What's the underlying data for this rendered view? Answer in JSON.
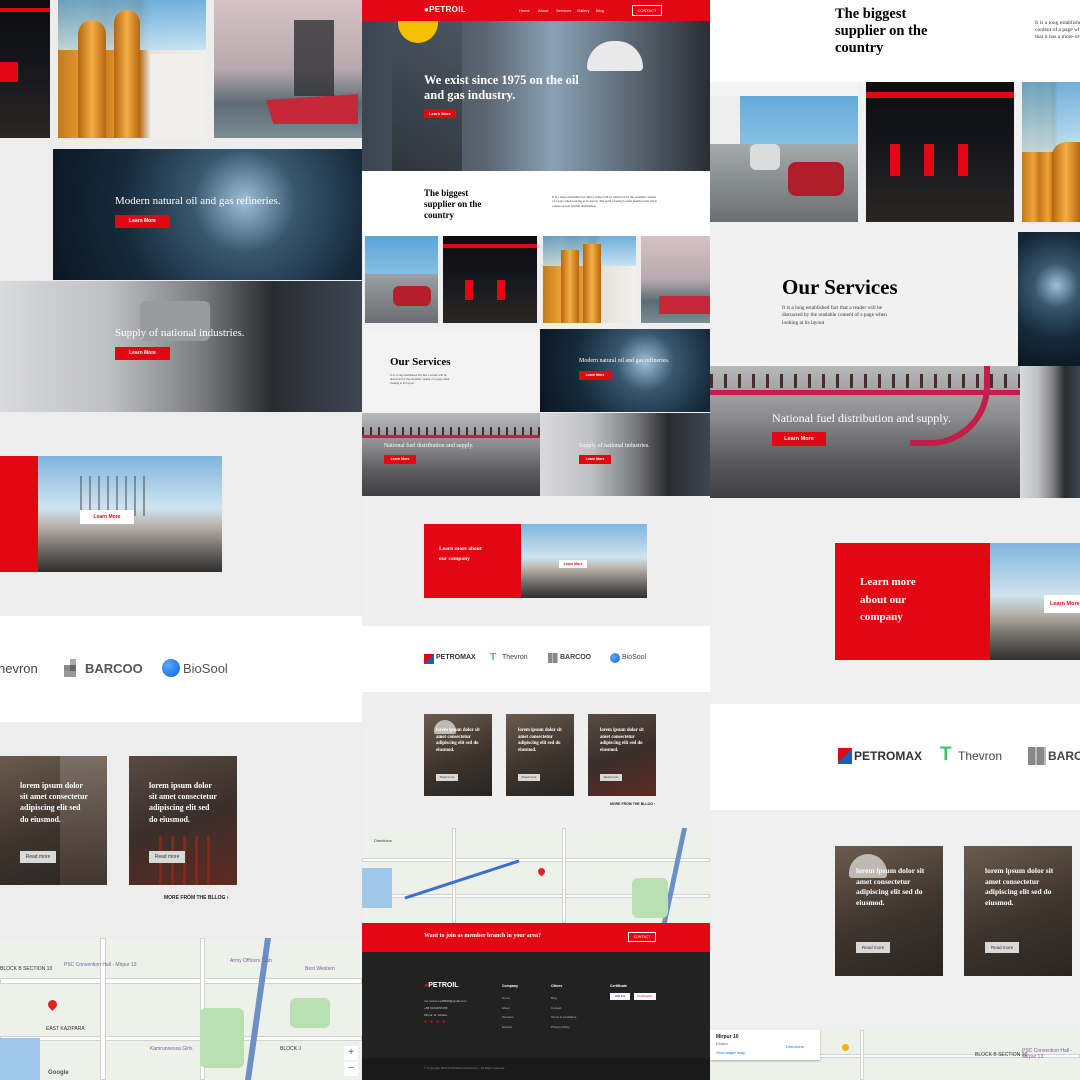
{
  "brand": {
    "name": "PETROIL",
    "accent": "#e30613"
  },
  "nav": {
    "links": [
      "Home",
      "About",
      "Services",
      "Gallery",
      "Blog"
    ],
    "contact_button": "CONTACT"
  },
  "hero": {
    "headline": "We exist since 1975 on the oil and gas industry.",
    "button": "Learn More"
  },
  "supplier": {
    "title": "The biggest supplier on the country",
    "body": "It is a long established fact that a reader will be distracted by the readable content of a page when looking at its layout. The point of using Lorem Ipsum is that it has a more-or-less normal distribution.",
    "body_right_crop": "It is a long establishe content of a page wha that it has a more-or-l"
  },
  "services": {
    "title": "Our Services",
    "body": "It is a long established fact that a reader will be distracted by the readable content of a page when looking at its layout",
    "items": [
      {
        "title": "Modern natural oil and gas refineries.",
        "button": "Learn More"
      },
      {
        "title": "National fuel distribution and supply.",
        "button": "Learn More"
      },
      {
        "title": "Supply of national industries.",
        "button": "Learn More"
      }
    ]
  },
  "about": {
    "text": "Learn more about our company",
    "button": "Learn More"
  },
  "partners": [
    {
      "name": "PETROMAX",
      "icon": "petromax-logo-icon"
    },
    {
      "name": "Thevron",
      "icon": "thevron-logo-icon"
    },
    {
      "name": "BARCOO",
      "icon": "barcoo-logo-icon"
    },
    {
      "name": "BioSool",
      "icon": "biosool-logo-icon"
    }
  ],
  "partners_left_crop": "hevron",
  "blog": {
    "posts": [
      {
        "title": "lorem ipsum dolor sit amet consectetur adipiscing elit sed do eiusmod.",
        "button": "Read more"
      },
      {
        "title": "lorem ipsum dolor sit amet consectetur adipiscing elit sed do eiusmod.",
        "button": "Read more"
      },
      {
        "title": "lorem ipsum dolor sit amet consectetur adipiscing elit sed do eiusmod.",
        "button": "Read more"
      }
    ],
    "more_link": "MORE FROM THE BLLOG"
  },
  "map": {
    "labels": [
      "PSC Convention Hall - Mirpur 13",
      "Army Officers Club",
      "Best Western",
      "EAST KAZIPARA",
      "BLOCK B SECTION 10",
      "Kamrunnessa Girls",
      "BLOCK J",
      "KAZIPARA",
      "Mirpur 10",
      "Dhaka",
      "View larger map",
      "Directions"
    ],
    "zoom_in": "+",
    "zoom_out": "−",
    "google": "Google"
  },
  "cta": {
    "text": "Want to join as member branch in your area?",
    "button": "CONTACT"
  },
  "footer": {
    "contacts": [
      "mo.mozum.ed8900@gmail.com",
      "+88 01234/56789",
      "Mirpur 11, Dhaka"
    ],
    "columns": [
      {
        "title": "Company",
        "items": [
          "Home",
          "About",
          "Services",
          "Explore"
        ]
      },
      {
        "title": "Others",
        "items": [
          "Blog",
          "Contact",
          "Terms & conditions",
          "Privacy Policy"
        ]
      },
      {
        "title": "Certificate",
        "items": [
          "ISO 9.9",
          "Certification"
        ]
      }
    ],
    "copyright": "© Copyright 2022 M Mohammad Mozum - All Right reserved"
  }
}
